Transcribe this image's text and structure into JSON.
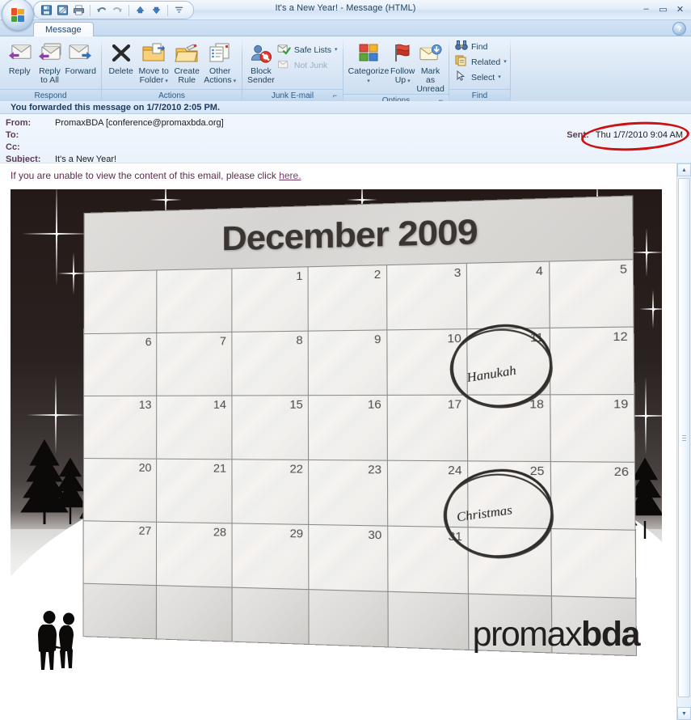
{
  "window": {
    "title": "It's a New Year! - Message (HTML)",
    "controls": {
      "minimize": "–",
      "maximize": "▭",
      "close": "✕"
    },
    "office_button": "office-orb",
    "help": "?"
  },
  "quick_access": {
    "items": [
      {
        "name": "save-icon",
        "tooltip": "Save"
      },
      {
        "name": "undo-typing-icon",
        "tooltip": "Undo"
      },
      {
        "name": "print-icon",
        "tooltip": "Print"
      },
      {
        "name": "undo-icon",
        "tooltip": "Undo"
      },
      {
        "name": "redo-icon",
        "tooltip": "Redo"
      },
      {
        "name": "previous-item-icon",
        "tooltip": "Previous Item"
      },
      {
        "name": "next-item-icon",
        "tooltip": "Next Item"
      },
      {
        "name": "customize-qat-icon",
        "tooltip": "Customize Quick Access Toolbar"
      }
    ]
  },
  "ribbon": {
    "tab": "Message",
    "groups": [
      {
        "label": "Respond",
        "has_launcher": false,
        "buttons": [
          {
            "label": "Reply",
            "name": "reply-button"
          },
          {
            "label": "Reply\nto All",
            "label_line1": "Reply",
            "label_line2": "to All",
            "name": "reply-all-button"
          },
          {
            "label": "Forward",
            "name": "forward-button"
          }
        ]
      },
      {
        "label": "Actions",
        "has_launcher": false,
        "buttons": [
          {
            "label_line1": "Delete",
            "label_line2": "",
            "name": "delete-button"
          },
          {
            "label_line1": "Move to",
            "label_line2": "Folder",
            "name": "move-to-folder-button",
            "dropdown": true
          },
          {
            "label_line1": "Create",
            "label_line2": "Rule",
            "name": "create-rule-button"
          },
          {
            "label_line1": "Other",
            "label_line2": "Actions",
            "name": "other-actions-button",
            "dropdown": true
          }
        ]
      },
      {
        "label": "Junk E-mail",
        "has_launcher": true,
        "big": {
          "label_line1": "Block",
          "label_line2": "Sender",
          "name": "block-sender-button"
        },
        "small": [
          {
            "label": "Safe Lists",
            "name": "safe-lists-button",
            "dropdown": true,
            "disabled": false
          },
          {
            "label": "Not Junk",
            "name": "not-junk-button",
            "dropdown": false,
            "disabled": true
          }
        ]
      },
      {
        "label": "Options",
        "has_launcher": true,
        "buttons": [
          {
            "label_line1": "Categorize",
            "label_line2": "",
            "name": "categorize-button",
            "dropdown": true
          },
          {
            "label_line1": "Follow",
            "label_line2": "Up",
            "name": "follow-up-button",
            "dropdown": true
          },
          {
            "label_line1": "Mark as",
            "label_line2": "Unread",
            "name": "mark-as-unread-button"
          }
        ]
      },
      {
        "label": "Find",
        "has_launcher": false,
        "small": [
          {
            "label": "Find",
            "name": "find-button",
            "dropdown": false
          },
          {
            "label": "Related",
            "name": "related-button",
            "dropdown": true
          },
          {
            "label": "Select",
            "name": "select-button",
            "dropdown": true
          }
        ]
      }
    ]
  },
  "message": {
    "info_bar": "You forwarded this message on 1/7/2010 2:05 PM.",
    "fields": [
      {
        "label": "From:",
        "value": "PromaxBDA [conference@promaxbda.org]"
      },
      {
        "label": "To:",
        "value": ""
      },
      {
        "label": "Cc:",
        "value": ""
      },
      {
        "label": "Subject:",
        "value": "It's a New Year!"
      }
    ],
    "sent_label": "Sent:",
    "sent_value": "Thu 1/7/2010 9:04 AM",
    "annotation_color": "#cc1111"
  },
  "body": {
    "fallback_text": "If you are unable to view the content of this email, please click ",
    "fallback_link": "here.",
    "image": {
      "calendar_title": "December 2009",
      "weeks": [
        [
          "",
          "",
          "1",
          "2",
          "3",
          "4",
          "5"
        ],
        [
          "6",
          "7",
          "8",
          "9",
          "10",
          "11",
          "12"
        ],
        [
          "13",
          "14",
          "15",
          "16",
          "17",
          "18",
          "19"
        ],
        [
          "20",
          "21",
          "22",
          "23",
          "24",
          "25",
          "26"
        ],
        [
          "27",
          "28",
          "29",
          "30",
          "31",
          "",
          ""
        ]
      ],
      "annotations": [
        {
          "text": "Hanukah",
          "circled_date": "11"
        },
        {
          "text": "Christmas",
          "circled_date": "25"
        }
      ],
      "logo_light": "promax",
      "logo_bold": "bda"
    }
  },
  "scrollbar": {
    "up": "▲",
    "down": "▼"
  }
}
